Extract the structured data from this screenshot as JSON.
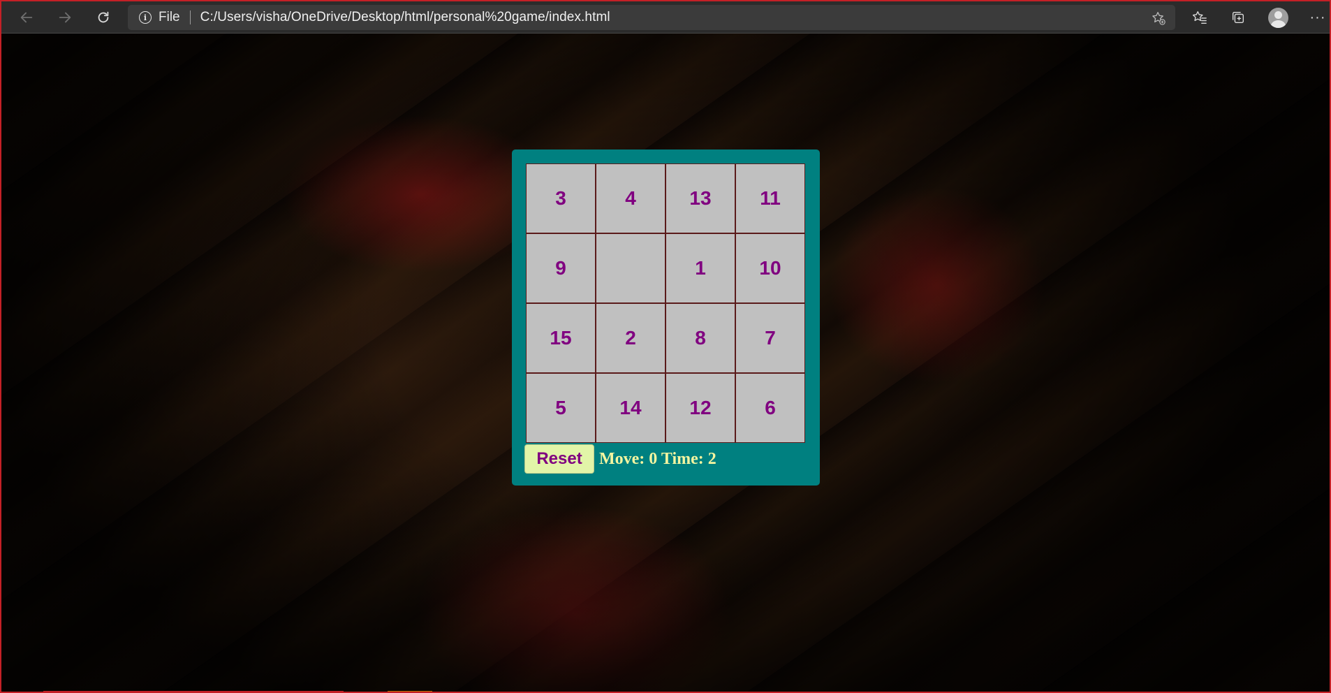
{
  "browser": {
    "scheme_label": "File",
    "url": "C:/Users/visha/OneDrive/Desktop/html/personal%20game/index.html",
    "icons": {
      "back": "back-arrow-icon",
      "forward": "forward-arrow-icon",
      "refresh": "refresh-icon",
      "info": "info-icon",
      "add_favorite": "star-plus-icon",
      "favorites": "favorites-icon",
      "collections": "collections-icon",
      "profile": "profile-avatar",
      "more": "more-icon"
    },
    "info_glyph": "i",
    "more_glyph": "···",
    "frame_color": "#c42026"
  },
  "game": {
    "tiles": [
      "3",
      "4",
      "13",
      "11",
      "9",
      "",
      "1",
      "10",
      "15",
      "2",
      "8",
      "7",
      "5",
      "14",
      "12",
      "6"
    ],
    "reset_label": "Reset",
    "status": "Move: 0 Time: 2",
    "colors": {
      "panel": "#008080",
      "tile": "#c0c0c0",
      "tile_text": "#800080",
      "reset_bg": "#e2f5a8",
      "status_text": "#f5f5a0"
    }
  }
}
